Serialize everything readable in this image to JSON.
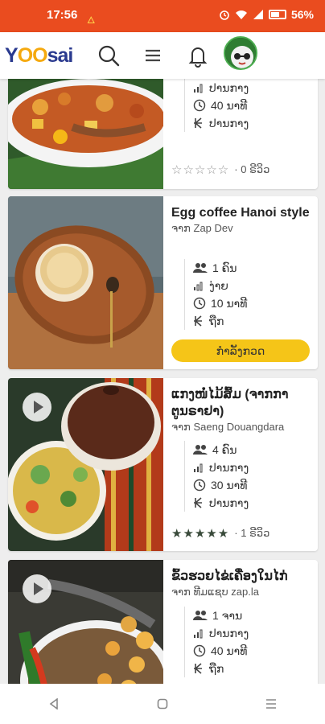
{
  "status_bar": {
    "time": "17:56",
    "battery_pct": "56%"
  },
  "header": {
    "logo_parts": [
      "Y",
      "OO",
      "sai"
    ],
    "icons": [
      "search-icon",
      "menu-icon",
      "bell-icon",
      "avatar"
    ]
  },
  "labels": {
    "by_prefix": "ຈາກ"
  },
  "cards": [
    {
      "title": "",
      "author": "",
      "servings": "",
      "difficulty": "ປານກາງ",
      "time": "40 ນາທີ",
      "cost": "ປານກາງ",
      "rating_text": "· 0 ຣີວິວ",
      "stars": "☆☆☆☆☆"
    },
    {
      "title": "Egg coffee Hanoi style",
      "author": "ຈາກ Zap Dev",
      "servings": "1 ຄົນ",
      "difficulty": "ງ່າຍ",
      "time": "10 ນາທີ",
      "cost": "ຖືກ",
      "button": "ກຳລັງກວດ"
    },
    {
      "title": "ແກງໜໍ່ໄມ້ສົ້ມ (ຈາກກາຕູນຣາຢາ)",
      "author": "ຈາກ Saeng Douangdara",
      "servings": "4 ຄົນ",
      "difficulty": "ປານກາງ",
      "time": "30 ນາທີ",
      "cost": "ປານກາງ",
      "rating_text": "· 1 ຣີວິວ",
      "stars": "★★★★★"
    },
    {
      "title": "ຂົ້ວຮວຍໄຂ່ເຄື່ອງໃນໄກ່",
      "author": "ຈາກ ທີມແຊບ zap.la",
      "servings": "1 ຈານ",
      "difficulty": "ປານກາງ",
      "time": "40 ນາທີ",
      "cost": "ຖືກ"
    }
  ],
  "colors": {
    "status_bar": "#ea4c1f",
    "accent_button": "#f5c518",
    "logo_blue": "#2a3a8f",
    "logo_orange": "#f5a90f"
  }
}
